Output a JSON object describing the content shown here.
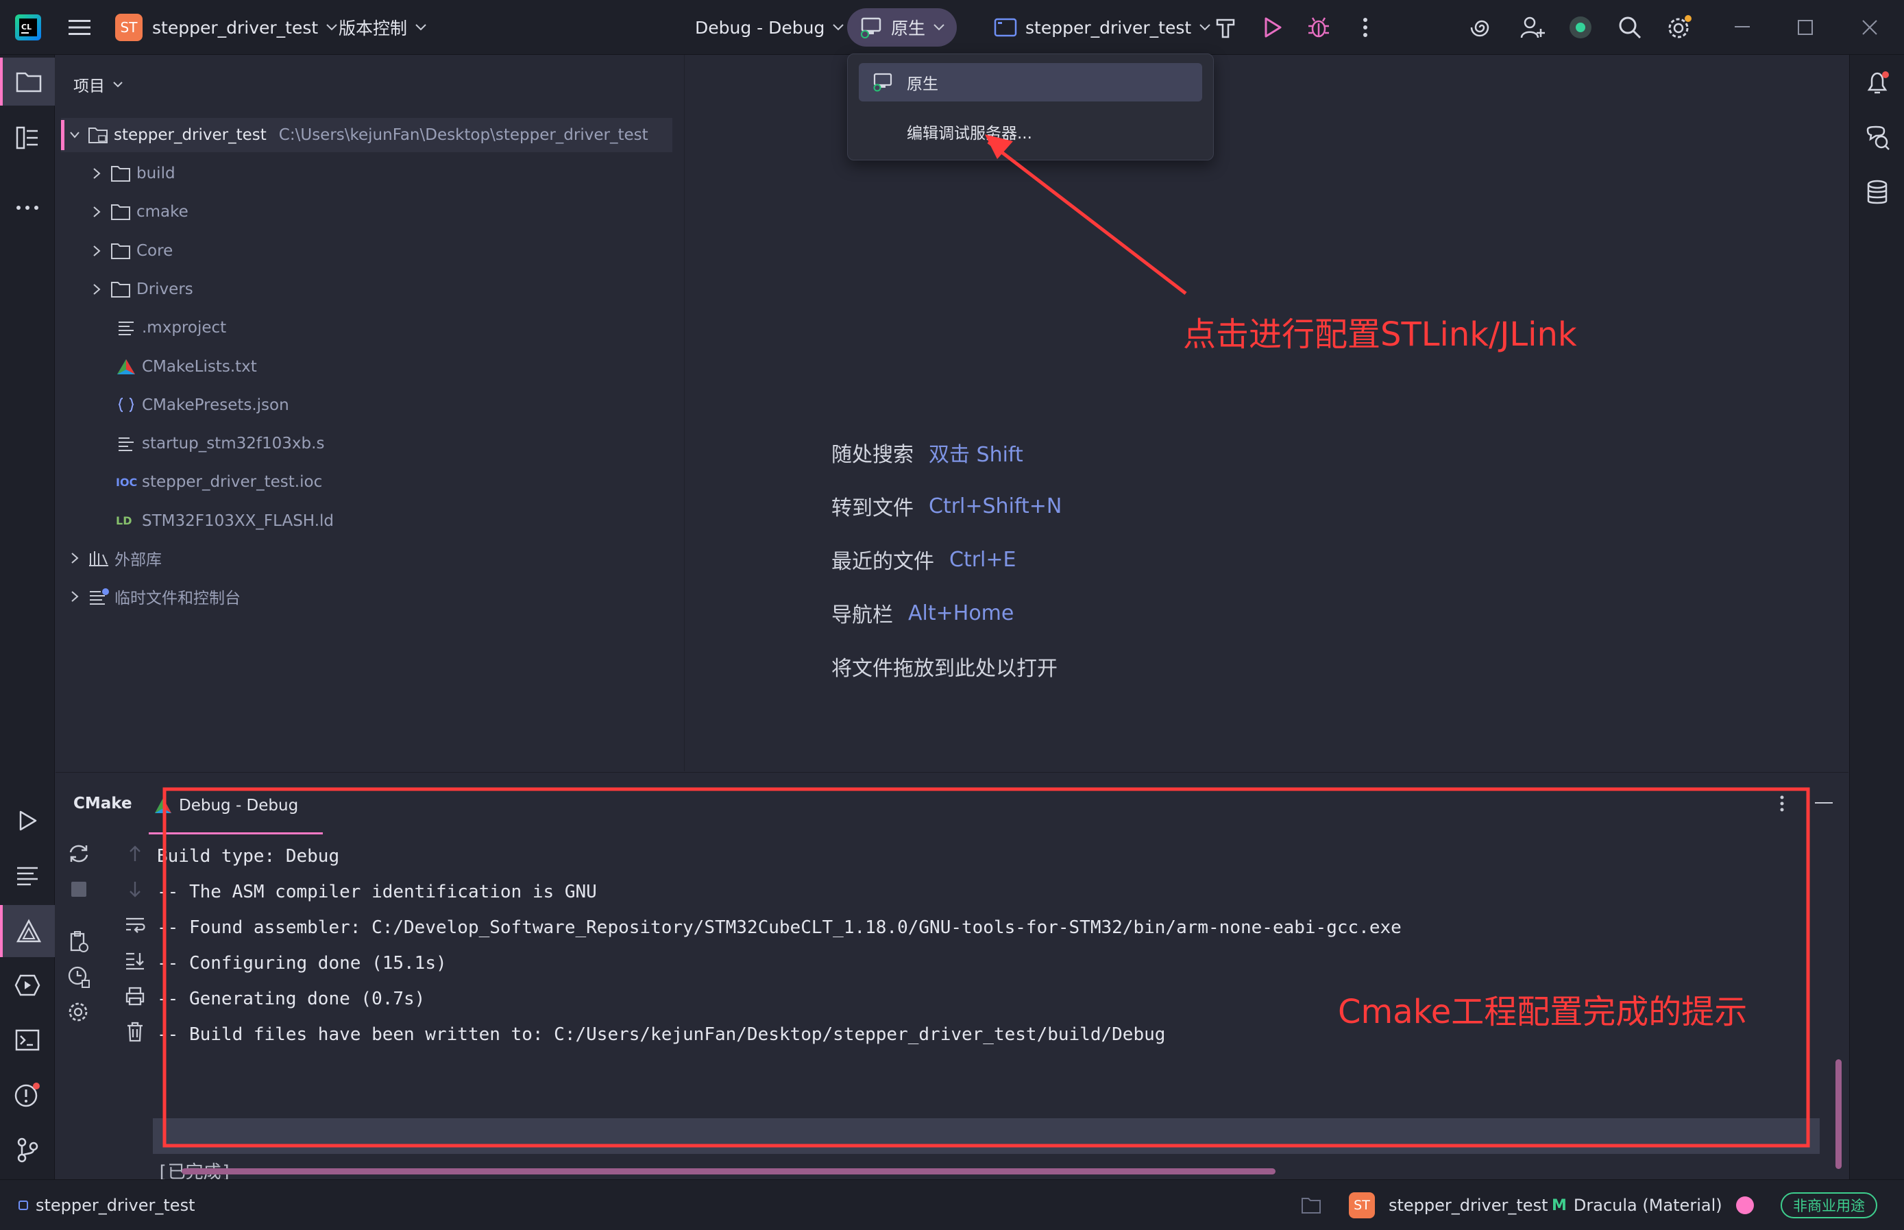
{
  "titlebar": {
    "project_badge": "ST",
    "project_name": "stepper_driver_test",
    "vcs_menu": "版本控制",
    "build_config": "Debug - Debug",
    "debugger_selector": "原生",
    "run_config": "stepper_driver_test"
  },
  "debugger_dropdown": {
    "items": [
      "原生",
      "编辑调试服务器..."
    ]
  },
  "project_panel": {
    "title": "项目",
    "root": {
      "name": "stepper_driver_test",
      "path": "C:\\Users\\kejunFan\\Desktop\\stepper_driver_test"
    },
    "items": [
      {
        "label": "build",
        "icon": "folder-icon"
      },
      {
        "label": "cmake",
        "icon": "folder-icon"
      },
      {
        "label": "Core",
        "icon": "folder-icon"
      },
      {
        "label": "Drivers",
        "icon": "folder-icon"
      },
      {
        "label": ".mxproject",
        "icon": "text-file-icon"
      },
      {
        "label": "CMakeLists.txt",
        "icon": "cmake-file-icon"
      },
      {
        "label": "CMakePresets.json",
        "icon": "json-file-icon"
      },
      {
        "label": "startup_stm32f103xb.s",
        "icon": "asm-file-icon"
      },
      {
        "label": "stepper_driver_test.ioc",
        "icon": "ioc-file-icon",
        "icon_text": "IOC"
      },
      {
        "label": "STM32F103XX_FLASH.ld",
        "icon": "ld-file-icon",
        "icon_text": "LD"
      }
    ],
    "external_libraries": "外部库",
    "scratches": "临时文件和控制台"
  },
  "editor_hints": [
    {
      "label": "随处搜索",
      "key": "双击 Shift"
    },
    {
      "label": "转到文件",
      "key": "Ctrl+Shift+N"
    },
    {
      "label": "最近的文件",
      "key": "Ctrl+E"
    },
    {
      "label": "导航栏",
      "key": "Alt+Home"
    },
    {
      "label": "将文件拖放到此处以打开",
      "key": ""
    }
  ],
  "bottom_panel": {
    "tool_title": "CMake",
    "tab_label": "Debug - Debug",
    "console_lines": [
      "Build type: Debug",
      "-- The ASM compiler identification is GNU",
      "-- Found assembler: C:/Develop_Software_Repository/STM32CubeCLT_1.18.0/GNU-tools-for-STM32/bin/arm-none-eabi-gcc.exe",
      "-- Configuring done (15.1s)",
      "-- Generating done (0.7s)",
      "-- Build files have been written to: C:/Users/kejunFan/Desktop/stepper_driver_test/build/Debug"
    ],
    "done_text": "[已完成]"
  },
  "annotations": {
    "debug_server_note": "点击进行配置STLink/JLink",
    "cmake_note": "Cmake工程配置完成的提示"
  },
  "statusbar": {
    "project": "stepper_driver_test",
    "badge": "ST",
    "project_right": "stepper_driver_test",
    "theme_badge": "M",
    "theme": "Dracula (Material)",
    "license": "非商业用途"
  },
  "colors": {
    "background": "#272935",
    "accent": "#ff79c6",
    "link": "#7f95e6",
    "annotation_red": "#ff3b3b"
  }
}
